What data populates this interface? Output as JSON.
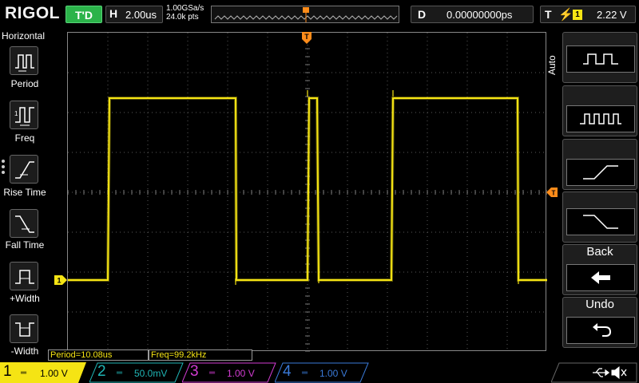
{
  "header": {
    "brand": "RIGOL",
    "run_state": "T'D",
    "horizontal_key": "H",
    "timebase": "2.00us",
    "sample_rate": "1.00GSa/s",
    "memory_depth": "24.0k pts",
    "delay_key": "D",
    "delay": "0.00000000ps",
    "trigger_key": "T",
    "trigger_source": "1",
    "trigger_level": "2.22 V"
  },
  "left_menu": {
    "title": "Horizontal",
    "items": [
      {
        "label": "Period",
        "icon": "period-icon"
      },
      {
        "label": "Freq",
        "icon": "frequency-icon"
      },
      {
        "label": "Rise Time",
        "icon": "rise-time-icon"
      },
      {
        "label": "Fall Time",
        "icon": "fall-time-icon"
      },
      {
        "label": "+Width",
        "icon": "positive-width-icon"
      },
      {
        "label": "-Width",
        "icon": "negative-width-icon"
      }
    ]
  },
  "right_menu": {
    "mode_label": "Auto",
    "back_label": "Back",
    "undo_label": "Undo",
    "items": [
      "pulse-wide-icon",
      "pulse-train-icon",
      "rising-edge-icon",
      "falling-edge-icon"
    ]
  },
  "measurements": {
    "period": "Period=10.08us",
    "freq": "Freq=99.2kHz"
  },
  "channels": [
    {
      "num": "1",
      "coupling": "═",
      "scale": "1.00 V",
      "color": "#f5e414"
    },
    {
      "num": "2",
      "coupling": "═",
      "scale": "50.0mV",
      "color": "#1fb5b5"
    },
    {
      "num": "3",
      "coupling": "═",
      "scale": "1.00 V",
      "color": "#d23cd2"
    },
    {
      "num": "4",
      "coupling": "═",
      "scale": "1.00 V",
      "color": "#3a7ad8"
    }
  ],
  "markers": {
    "trigger_pos": "T",
    "channel1": "1"
  },
  "colors": {
    "trace": "#f5e414",
    "run_badge": "#2bb34a",
    "trigger_marker": "#ff8c1a"
  }
}
